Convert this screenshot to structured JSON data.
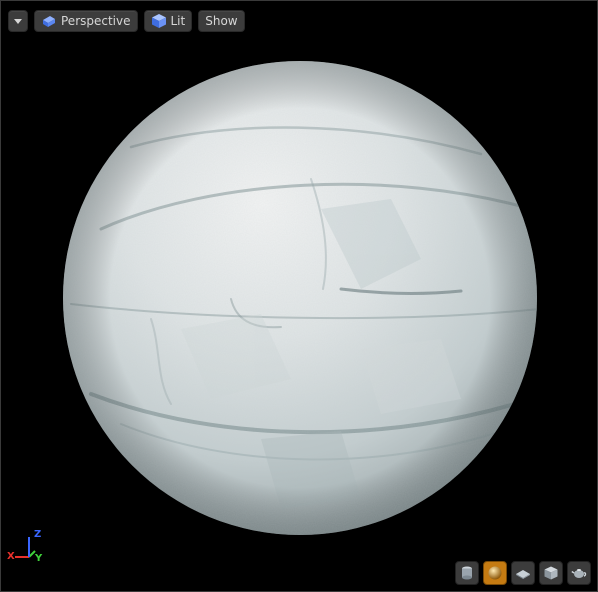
{
  "toolbar": {
    "perspective_label": "Perspective",
    "lit_label": "Lit",
    "show_label": "Show"
  },
  "axis": {
    "x_label": "X",
    "y_label": "Y",
    "z_label": "Z",
    "x_color": "#e8312b",
    "y_color": "#3fd13a",
    "z_color": "#3a66ff"
  },
  "preview_shapes": {
    "items": [
      "cylinder-icon",
      "sphere-icon",
      "plane-icon",
      "cube-icon",
      "teapot-icon"
    ],
    "active": "sphere-icon"
  },
  "colors": {
    "background": "#000000",
    "button_bg": "#3c3c3c",
    "active_accent": "#c57b12",
    "material_base": "#c8d2d4"
  }
}
